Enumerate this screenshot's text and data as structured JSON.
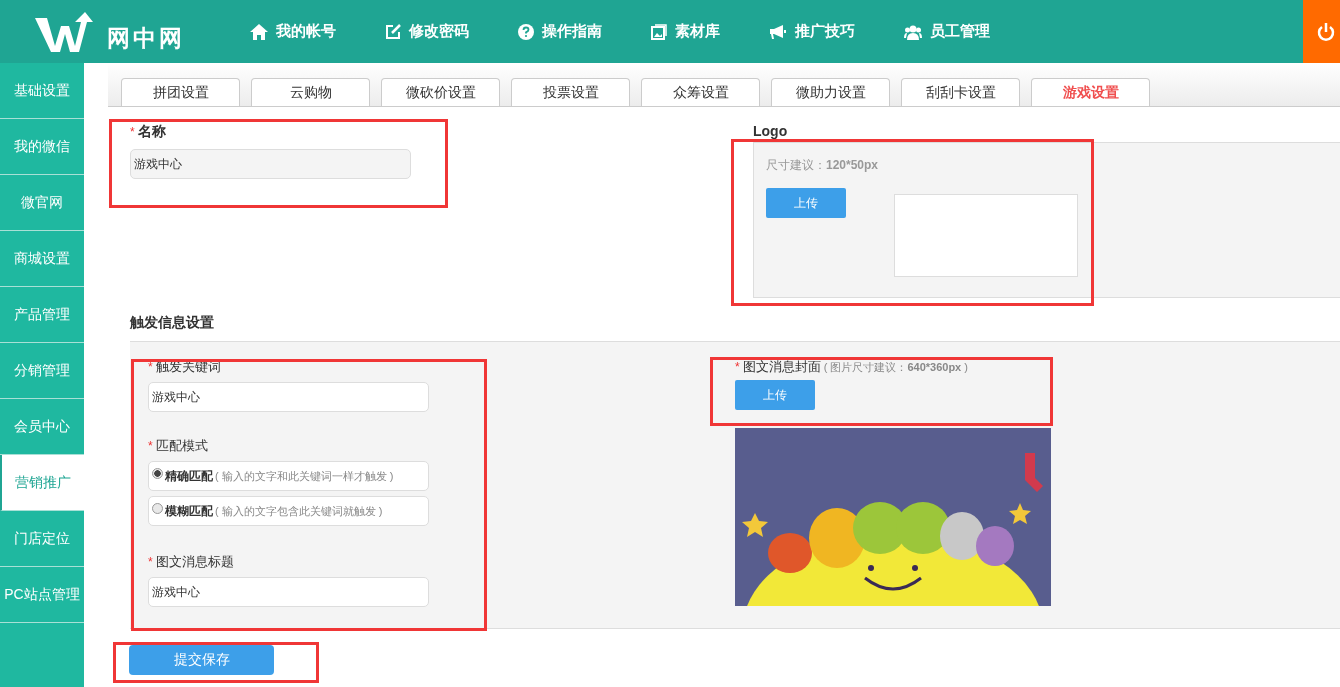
{
  "header": {
    "logo_text": "网中网",
    "nav": [
      {
        "label": "我的帐号"
      },
      {
        "label": "修改密码"
      },
      {
        "label": "操作指南"
      },
      {
        "label": "素材库"
      },
      {
        "label": "推广技巧"
      },
      {
        "label": "员工管理"
      }
    ]
  },
  "sidebar": {
    "items": [
      {
        "label": "基础设置",
        "selected": false
      },
      {
        "label": "我的微信",
        "selected": false
      },
      {
        "label": "微官网",
        "selected": false
      },
      {
        "label": "商城设置",
        "selected": false
      },
      {
        "label": "产品管理",
        "selected": false
      },
      {
        "label": "分销管理",
        "selected": false
      },
      {
        "label": "会员中心",
        "selected": false
      },
      {
        "label": "营销推广",
        "selected": true
      },
      {
        "label": "门店定位",
        "selected": false
      },
      {
        "label": "PC站点管理",
        "selected": false
      }
    ]
  },
  "tabs": [
    {
      "label": "拼团设置",
      "selected": false
    },
    {
      "label": "云购物",
      "selected": false
    },
    {
      "label": "微砍价设置",
      "selected": false
    },
    {
      "label": "投票设置",
      "selected": false
    },
    {
      "label": "众筹设置",
      "selected": false
    },
    {
      "label": "微助力设置",
      "selected": false
    },
    {
      "label": "刮刮卡设置",
      "selected": false
    },
    {
      "label": "游戏设置",
      "selected": true
    }
  ],
  "name_field": {
    "label": "名称",
    "required_mark": "*",
    "value": "游戏中心"
  },
  "logo": {
    "label": "Logo",
    "hint": "尺寸建议：**120*50px**",
    "upload_button": "上传"
  },
  "trigger_section": {
    "title": "触发信息设置",
    "keyword": {
      "label": "触发关键词",
      "required_mark": "*",
      "value": "游戏中心"
    },
    "match_mode": {
      "label": "匹配模式",
      "required_mark": "*",
      "options": [
        {
          "label": "精确匹配",
          "hint": "( 输入的文字和此关键词一样才触发 )",
          "selected": true
        },
        {
          "label": "模糊匹配",
          "hint": "( 输入的文字包含此关键词就触发 )",
          "selected": false
        }
      ]
    },
    "news_title": {
      "label": "图文消息标题",
      "required_mark": "*",
      "value": "游戏中心"
    },
    "cover": {
      "label": "图文消息封面",
      "required_mark": "*",
      "hint": "( 图片尺寸建议：**640*360px** )",
      "upload_button": "上传"
    }
  },
  "submit_button": "提交保存"
}
